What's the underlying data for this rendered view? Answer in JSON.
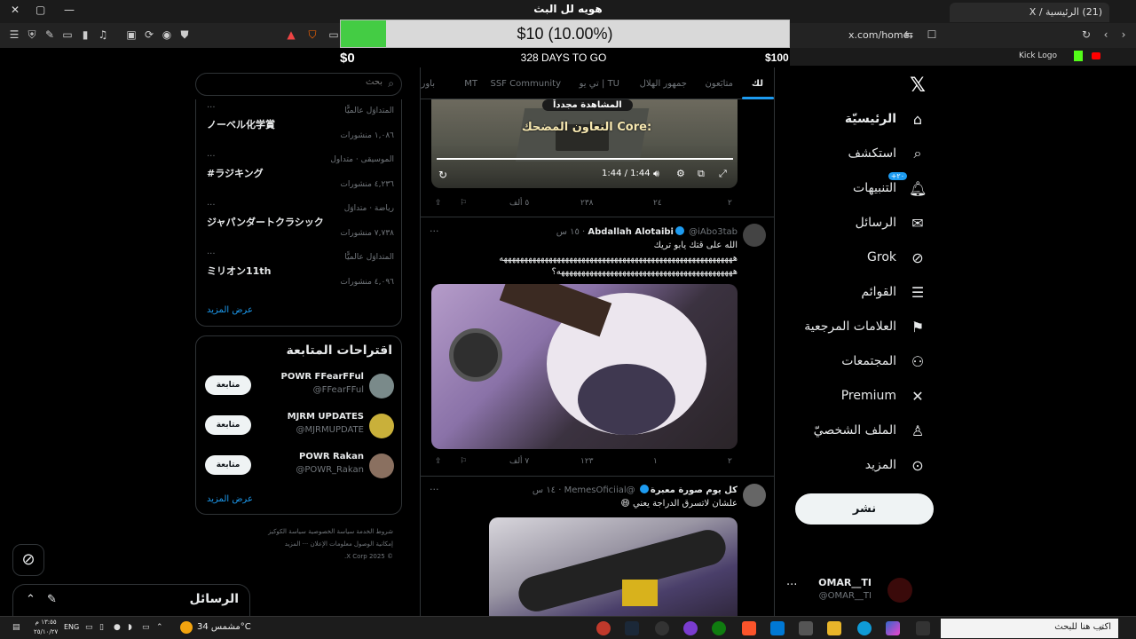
{
  "browser": {
    "tab_title": "(21) الرئيسية / X",
    "stream_title": "هويه لل البث",
    "url": "x.com/home",
    "bookmark_kick": "Kick Logo"
  },
  "donation": {
    "amount_text": "$10 (10.00%)",
    "progress_fraction": 0.1,
    "min_label": "$0",
    "max_label": "$100",
    "days_label": "328 DAYS TO GO"
  },
  "nav": {
    "items": [
      {
        "label": "الرئيسيّة",
        "icon": "home-icon"
      },
      {
        "label": "استكشف",
        "icon": "search-icon"
      },
      {
        "label": "التنبيهات",
        "icon": "bell-icon",
        "badge": "+٢٠"
      },
      {
        "label": "الرسائل",
        "icon": "mail-icon"
      },
      {
        "label": "Grok",
        "icon": "grok-icon"
      },
      {
        "label": "القوائم",
        "icon": "list-icon"
      },
      {
        "label": "العلامات المرجعية",
        "icon": "bookmark-icon"
      },
      {
        "label": "المجتمعات",
        "icon": "communities-icon"
      },
      {
        "label": "Premium",
        "icon": "x-icon"
      },
      {
        "label": "الملف الشخصيّ",
        "icon": "profile-icon"
      },
      {
        "label": "المزيد",
        "icon": "more-icon"
      }
    ],
    "post_label": "نشر",
    "account": {
      "name": "OMAR__TI",
      "handle": "@OMAR__TI"
    }
  },
  "feed": {
    "tabs": [
      "لك",
      "متابَعون",
      "جمهور الهلال",
      "تي يو | TU",
      "SSF Community",
      "MT",
      "باور"
    ],
    "video": {
      "pill": "المشاهدة مجدداً",
      "caption": "التعاون المضحك Core:",
      "time": "1:44 / 1:44"
    },
    "video_actions": {
      "replies": "٢",
      "reposts": "٢٤",
      "likes": "٢٣٨",
      "views": "٥ ألف"
    },
    "tweet1": {
      "name": "Abdallah Alotaibi",
      "handle": "@iAbo3tab",
      "time": "١٥ س",
      "text_line1": "الله على قتك يابو تريك",
      "text_line2": "هههههههههههههههههههههههههههههههههههههههههههههههههههههههههه",
      "text_line3": "هههههههههههههههههههههههههههههههههههههههههههه؟",
      "actions": {
        "replies": "٢",
        "reposts": "١",
        "likes": "١٢٣",
        "views": "٧ ألف"
      }
    },
    "tweet2": {
      "name": "كل يوم صورة معبرة",
      "handle": "@MemesOficiial",
      "time": "١٤ س",
      "text": "علشان لاتسرق الدراجة يعني 😄"
    }
  },
  "sidebar": {
    "search_placeholder": "بحث",
    "trends": [
      {
        "context": "المتداوَل عالميًّا",
        "title": "ノーベル化学賞",
        "count": "١,٠٨٦ منشورات"
      },
      {
        "context": "الموسيقى · متداول",
        "title": "#ラジキング",
        "count": "٤,٢٣٦ منشورات"
      },
      {
        "context": "رياضة · متداوَل",
        "title": "ジャパンダートクラシック",
        "count": "٧,٧٣٨ منشورات"
      },
      {
        "context": "المتداوَل عالميًّا",
        "title": "ミリオン11th",
        "count": "٤,٠٩٦ منشورات"
      }
    ],
    "trends_more": "عرض المزيد",
    "who_to_follow": {
      "title": "اقتراحات المتابعة",
      "follow_label": "متابعة",
      "more": "عرض المزيد",
      "suggestions": [
        {
          "name": "POWR FFearFFul",
          "handle": "@FFearFFul"
        },
        {
          "name": "MJRM UPDATES",
          "handle": "@MJRMUPDATE"
        },
        {
          "name": "POWR Rakan",
          "handle": "@POWR_Rakan"
        }
      ]
    },
    "footer": {
      "line1": "شروط الخدمة   سياسة الخصوصية   سياسة الكوكيز",
      "line2": "إمكانية الوصول   معلومات الإعلان   ··· المزيد",
      "line3": "© 2025 X Corp."
    }
  },
  "messages_drawer": {
    "title": "الرسائل"
  },
  "taskbar": {
    "search_placeholder": "اكتب هنا للبحث",
    "weather": "مشمس 34°C",
    "lang": "ENG",
    "time": "١٣:٥٥ م",
    "date": "٢٥/١٠/٢٧"
  },
  "colors": {
    "accent": "#1d9bf0",
    "donation_fill": "#44cc44"
  }
}
